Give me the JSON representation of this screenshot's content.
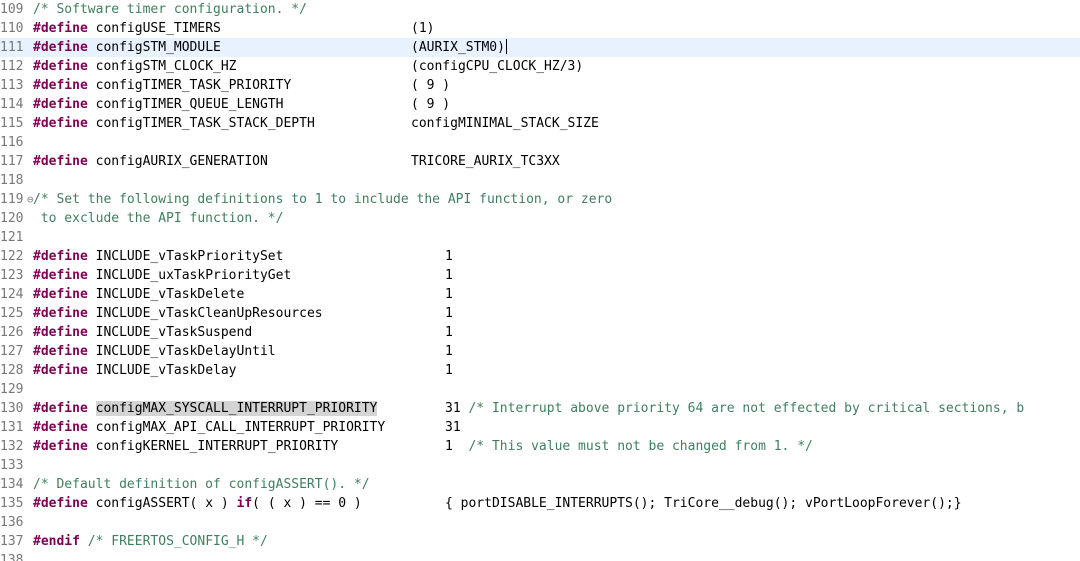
{
  "editor": {
    "lines": [
      {
        "no": "109",
        "parts": [
          {
            "t": "/* Software timer configuration. */",
            "k": "cm"
          }
        ]
      },
      {
        "no": "110",
        "parts": [
          {
            "t": "#define",
            "k": "kw"
          },
          {
            "t": " configUSE_TIMERS",
            "k": ""
          }
        ],
        "val": "(1)",
        "col": 411
      },
      {
        "no": "111",
        "current": true,
        "parts": [
          {
            "t": "#define",
            "k": "kw"
          },
          {
            "t": " configSTM_MODULE",
            "k": ""
          }
        ],
        "val": "(AURIX_STM0)",
        "col": 411,
        "caret": true
      },
      {
        "no": "112",
        "parts": [
          {
            "t": "#define",
            "k": "kw"
          },
          {
            "t": " configSTM_CLOCK_HZ",
            "k": ""
          }
        ],
        "val": "(configCPU_CLOCK_HZ/3)",
        "col": 411
      },
      {
        "no": "113",
        "parts": [
          {
            "t": "#define",
            "k": "kw"
          },
          {
            "t": " configTIMER_TASK_PRIORITY",
            "k": ""
          }
        ],
        "val": "( 9 )",
        "col": 411
      },
      {
        "no": "114",
        "parts": [
          {
            "t": "#define",
            "k": "kw"
          },
          {
            "t": " configTIMER_QUEUE_LENGTH",
            "k": ""
          }
        ],
        "val": "( 9 )",
        "col": 411
      },
      {
        "no": "115",
        "parts": [
          {
            "t": "#define",
            "k": "kw"
          },
          {
            "t": " configTIMER_TASK_STACK_DEPTH",
            "k": ""
          }
        ],
        "val": "configMINIMAL_STACK_SIZE",
        "col": 411
      },
      {
        "no": "116",
        "parts": []
      },
      {
        "no": "117",
        "parts": [
          {
            "t": "#define",
            "k": "kw"
          },
          {
            "t": " configAURIX_GENERATION",
            "k": ""
          }
        ],
        "val": "TRICORE_AURIX_TC3XX",
        "col": 411
      },
      {
        "no": "118",
        "parts": []
      },
      {
        "no": "119",
        "fold": "⊖",
        "parts": [
          {
            "t": "/* Set the following definitions to 1 to include the API function, or zero",
            "k": "cm"
          }
        ]
      },
      {
        "no": "120",
        "parts": [
          {
            "t": " to exclude the API function. */",
            "k": "cm"
          }
        ]
      },
      {
        "no": "121",
        "parts": []
      },
      {
        "no": "122",
        "parts": [
          {
            "t": "#define",
            "k": "kw"
          },
          {
            "t": " INCLUDE_vTaskPrioritySet",
            "k": ""
          }
        ],
        "val": "1",
        "col": 445
      },
      {
        "no": "123",
        "parts": [
          {
            "t": "#define",
            "k": "kw"
          },
          {
            "t": " INCLUDE_uxTaskPriorityGet",
            "k": ""
          }
        ],
        "val": "1",
        "col": 445
      },
      {
        "no": "124",
        "parts": [
          {
            "t": "#define",
            "k": "kw"
          },
          {
            "t": " INCLUDE_vTaskDelete",
            "k": ""
          }
        ],
        "val": "1",
        "col": 445
      },
      {
        "no": "125",
        "parts": [
          {
            "t": "#define",
            "k": "kw"
          },
          {
            "t": " INCLUDE_vTaskCleanUpResources",
            "k": ""
          }
        ],
        "val": "1",
        "col": 445
      },
      {
        "no": "126",
        "parts": [
          {
            "t": "#define",
            "k": "kw"
          },
          {
            "t": " INCLUDE_vTaskSuspend",
            "k": ""
          }
        ],
        "val": "1",
        "col": 445
      },
      {
        "no": "127",
        "parts": [
          {
            "t": "#define",
            "k": "kw"
          },
          {
            "t": " INCLUDE_vTaskDelayUntil",
            "k": ""
          }
        ],
        "val": "1",
        "col": 445
      },
      {
        "no": "128",
        "parts": [
          {
            "t": "#define",
            "k": "kw"
          },
          {
            "t": " INCLUDE_vTaskDelay",
            "k": ""
          }
        ],
        "val": "1",
        "col": 445
      },
      {
        "no": "129",
        "parts": []
      },
      {
        "no": "130",
        "parts": [
          {
            "t": "#define",
            "k": "kw"
          },
          {
            "t": " ",
            "k": ""
          },
          {
            "t": "configMAX_SYSCALL_INTERRUPT_PRIORITY",
            "k": "hl"
          }
        ],
        "val": "31",
        "col": 445,
        "comment": " /* Interrupt above priority 64 are not effected by critical sections, b"
      },
      {
        "no": "131",
        "parts": [
          {
            "t": "#define",
            "k": "kw"
          },
          {
            "t": " configMAX_API_CALL_INTERRUPT_PRIORITY",
            "k": ""
          }
        ],
        "val": "31",
        "col": 445
      },
      {
        "no": "132",
        "parts": [
          {
            "t": "#define",
            "k": "kw"
          },
          {
            "t": " configKERNEL_INTERRUPT_PRIORITY",
            "k": ""
          }
        ],
        "val": "1",
        "col": 445,
        "comment": "  /* This value must not be changed from 1. */"
      },
      {
        "no": "133",
        "parts": []
      },
      {
        "no": "134",
        "parts": [
          {
            "t": "/* Default definition of configASSERT(). */",
            "k": "cm"
          }
        ]
      },
      {
        "no": "135",
        "parts": [
          {
            "t": "#define",
            "k": "kw"
          },
          {
            "t": " configASSERT( x ) ",
            "k": ""
          },
          {
            "t": "if",
            "k": "kw"
          },
          {
            "t": "( ( x ) == 0 )",
            "k": ""
          }
        ],
        "val": "{ portDISABLE_INTERRUPTS(); TriCore__debug(); vPortLoopForever();}",
        "col": 445
      },
      {
        "no": "136",
        "parts": []
      },
      {
        "no": "137",
        "parts": [
          {
            "t": "#endif",
            "k": "kw"
          },
          {
            "t": " ",
            "k": ""
          },
          {
            "t": "/* FREERTOS_CONFIG_H */",
            "k": "cm"
          }
        ]
      },
      {
        "no": "138",
        "parts": []
      }
    ]
  }
}
